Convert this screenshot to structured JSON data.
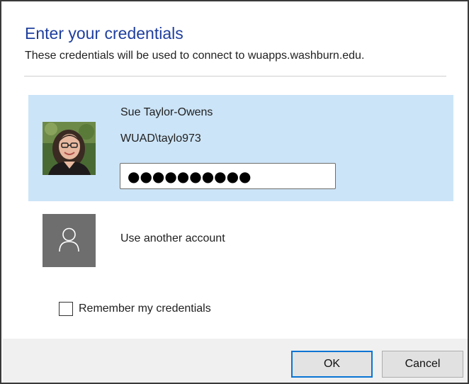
{
  "dialog": {
    "title": "Enter your credentials",
    "subtitle": "These credentials will be used to connect to wuapps.washburn.edu."
  },
  "accounts": {
    "selected": {
      "name": "Sue Taylor-Owens",
      "username": "WUAD\\taylo973",
      "password_masked": "●●●●●●●●●●"
    },
    "other": {
      "label": "Use another account",
      "icon": "person-icon"
    }
  },
  "remember": {
    "label": "Remember my credentials",
    "checked": false
  },
  "buttons": {
    "ok_label": "OK",
    "cancel_label": "Cancel"
  },
  "colors": {
    "title": "#1f3f9e",
    "selected_bg": "#cce4f7",
    "ok_border": "#0a74d4",
    "footer_bg": "#f0f0f0",
    "generic_avatar_bg": "#6e6e6e"
  }
}
